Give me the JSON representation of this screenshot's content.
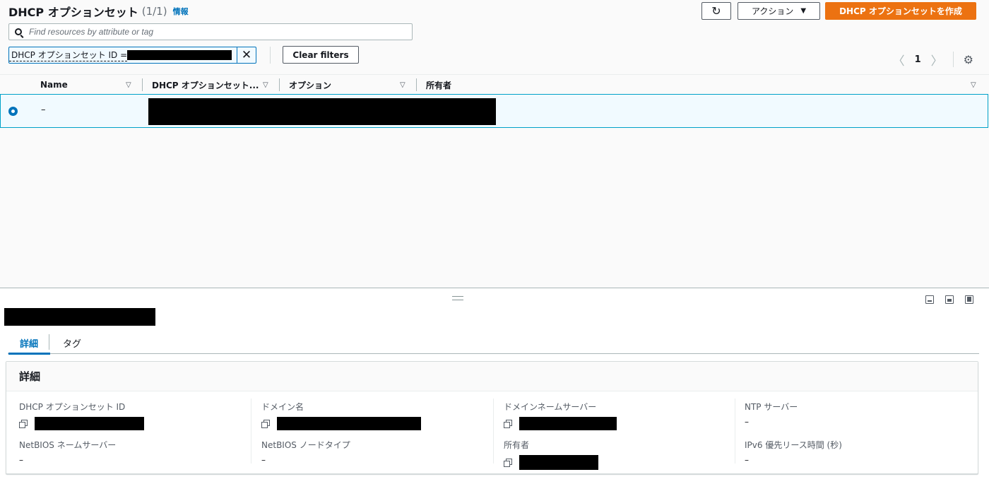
{
  "header": {
    "title": "DHCP オプションセット",
    "count": "(1/1)",
    "info_link": "情報",
    "refresh_icon": "refresh-icon",
    "actions_label": "アクション",
    "create_label": "DHCP オプションセットを作成"
  },
  "search": {
    "placeholder": "Find resources by attribute or tag"
  },
  "filter_token": {
    "label": "DHCP オプションセット ID ="
  },
  "clear_filters_label": "Clear filters",
  "pagination": {
    "page": "1"
  },
  "table": {
    "columns": [
      "Name",
      "DHCP オプションセット...",
      "オプション",
      "所有者"
    ],
    "rows": [
      {
        "name": "–",
        "selected": true
      }
    ]
  },
  "detail": {
    "tabs": [
      "詳細",
      "タグ"
    ],
    "active_tab": "詳細",
    "section_title": "詳細",
    "fields": {
      "dhcp_id_label": "DHCP オプションセット ID",
      "domain_name_label": "ドメイン名",
      "dns_label": "ドメインネームサーバー",
      "ntp_label": "NTP サーバー",
      "ntp_value": "–",
      "netbios_ns_label": "NetBIOS ネームサーバー",
      "netbios_ns_value": "–",
      "netbios_type_label": "NetBIOS ノードタイプ",
      "netbios_type_value": "–",
      "owner_label": "所有者",
      "ipv6_label": "IPv6 優先リース時間 (秒)",
      "ipv6_value": "–"
    }
  },
  "colors": {
    "primary_orange": "#ec7211",
    "link_blue": "#0073bb",
    "selected_row_bg": "#f1faff",
    "selected_row_border": "#00a1c9"
  }
}
